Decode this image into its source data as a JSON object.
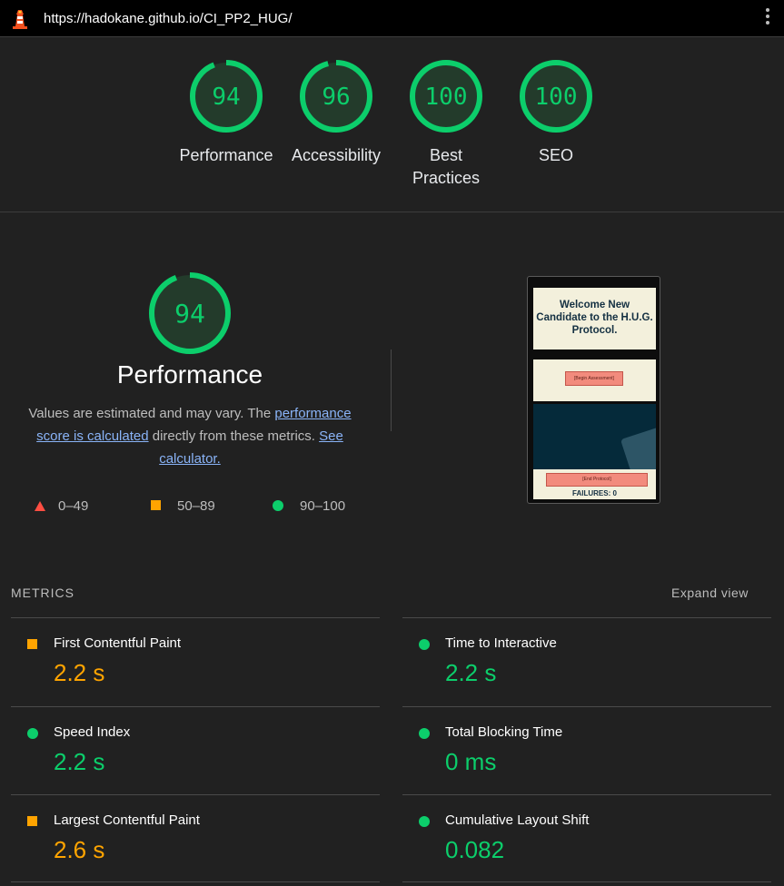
{
  "browser": {
    "url": "https://hadokane.github.io/CI_PP2_HUG/",
    "logo_icon": "lighthouse-icon",
    "menu_icon": "kebab-menu-icon"
  },
  "colors": {
    "pass": "#0cce6b",
    "average": "#ffa400",
    "fail": "#ff4e42",
    "link": "#8ab4f8"
  },
  "gauges": [
    {
      "score": 94,
      "label_line1": "Performance",
      "label_line2": ""
    },
    {
      "score": 96,
      "label_line1": "Accessibility",
      "label_line2": ""
    },
    {
      "score": 100,
      "label_line1": "Best",
      "label_line2": "Practices"
    },
    {
      "score": 100,
      "label_line1": "SEO",
      "label_line2": ""
    }
  ],
  "performance": {
    "score": 94,
    "title": "Performance",
    "desc_prefix": "Values are estimated and may vary. The ",
    "desc_link1": "performance score is calculated",
    "desc_middle": " directly from these metrics. ",
    "desc_link2": "See calculator."
  },
  "legend": {
    "fail_range": "0–49",
    "average_range": "50–89",
    "pass_range": "90–100"
  },
  "screenshot": {
    "heading": "Welcome New Candidate to the H.U.G. Protocol.",
    "begin_button": "[Begin Assessment]",
    "end_button": "[End Protocol]",
    "failures": "FAILURES: 0"
  },
  "metrics": {
    "header": "METRICS",
    "expand_label": "Expand view",
    "items": [
      {
        "label": "First Contentful Paint",
        "value": "2.2 s",
        "status": "average"
      },
      {
        "label": "Time to Interactive",
        "value": "2.2 s",
        "status": "pass"
      },
      {
        "label": "Speed Index",
        "value": "2.2 s",
        "status": "pass"
      },
      {
        "label": "Total Blocking Time",
        "value": "0 ms",
        "status": "pass"
      },
      {
        "label": "Largest Contentful Paint",
        "value": "2.6 s",
        "status": "average"
      },
      {
        "label": "Cumulative Layout Shift",
        "value": "0.082",
        "status": "pass"
      }
    ]
  }
}
